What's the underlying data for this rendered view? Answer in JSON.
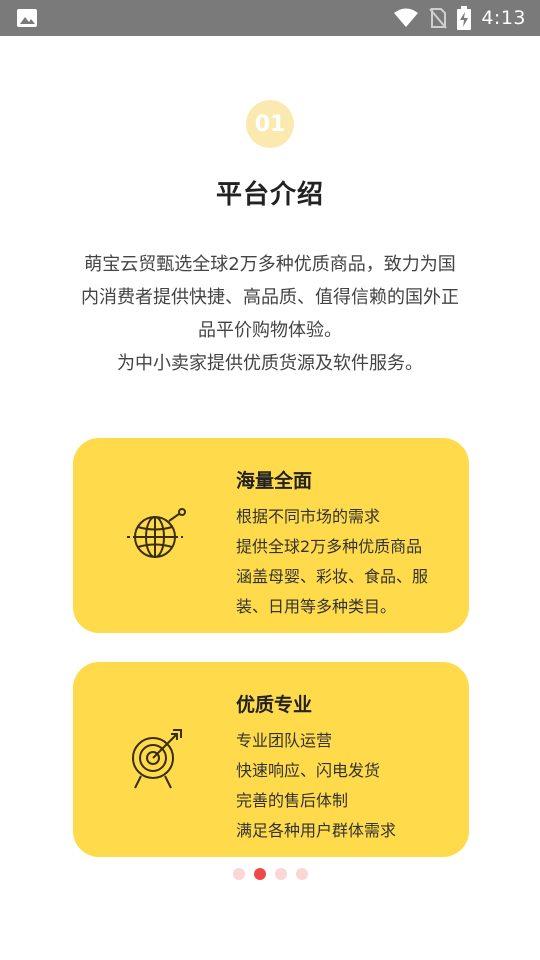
{
  "status_bar": {
    "time": "4:13",
    "icons": [
      "image-icon",
      "wifi-icon",
      "no-sim-icon",
      "battery-charging-icon"
    ]
  },
  "badge": {
    "number": "01"
  },
  "section": {
    "title": "平台介绍",
    "intro": [
      "萌宝云贸甄选全球2万多种优质商品，致力为国",
      "内消费者提供快捷、高品质、值得信赖的国外正",
      "品平价购物体验。",
      "为中小卖家提供优质货源及软件服务。"
    ]
  },
  "cards": [
    {
      "title": "海量全面",
      "icon": "globe-icon",
      "lines": [
        "根据不同市场的需求",
        "提供全球2万多种优质商品",
        "涵盖母婴、彩妆、食品、服",
        "装、日用等多种类目。"
      ]
    },
    {
      "title": "优质专业",
      "icon": "target-icon",
      "lines": [
        "专业团队运营",
        "快速响应、闪电发货",
        "完善的售后体制",
        "满足各种用户群体需求"
      ]
    }
  ],
  "pager": {
    "count": 4,
    "active_index": 1
  },
  "colors": {
    "card_bg": "#ffdb4c",
    "badge_bg": "#fbeab0",
    "dot_active": "#f04848",
    "dot_inactive": "#fbd6d6",
    "status_bg": "#7a7a7a"
  }
}
